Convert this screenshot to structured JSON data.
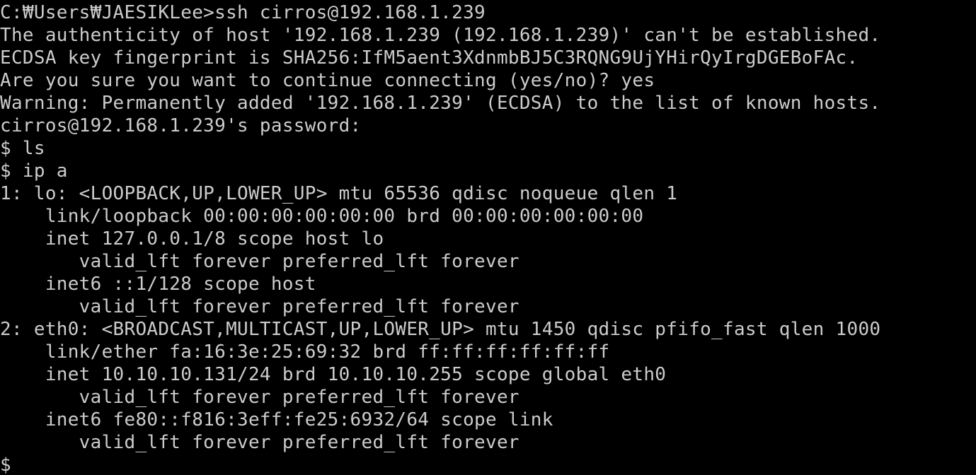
{
  "terminal": {
    "lines": [
      "C:₩Users₩JAESIKLee>ssh cirros@192.168.1.239",
      "The authenticity of host '192.168.1.239 (192.168.1.239)' can't be established.",
      "ECDSA key fingerprint is SHA256:IfM5aent3XdnmbBJ5C3RQNG9UjYHirQyIrgDGEBoFAc.",
      "Are you sure you want to continue connecting (yes/no)? yes",
      "Warning: Permanently added '192.168.1.239' (ECDSA) to the list of known hosts.",
      "cirros@192.168.1.239's password:",
      "$ ls",
      "$ ip a",
      "1: lo: <LOOPBACK,UP,LOWER_UP> mtu 65536 qdisc noqueue qlen 1",
      "    link/loopback 00:00:00:00:00:00 brd 00:00:00:00:00:00",
      "    inet 127.0.0.1/8 scope host lo",
      "       valid_lft forever preferred_lft forever",
      "    inet6 ::1/128 scope host",
      "       valid_lft forever preferred_lft forever",
      "2: eth0: <BROADCAST,MULTICAST,UP,LOWER_UP> mtu 1450 qdisc pfifo_fast qlen 1000",
      "    link/ether fa:16:3e:25:69:32 brd ff:ff:ff:ff:ff:ff",
      "    inet 10.10.10.131/24 brd 10.10.10.255 scope global eth0",
      "       valid_lft forever preferred_lft forever",
      "    inet6 fe80::f816:3eff:fe25:6932/64 scope link",
      "       valid_lft forever preferred_lft forever"
    ],
    "prompt": "$",
    "colors": {
      "background": "#000000",
      "foreground": "#cccccc"
    }
  }
}
